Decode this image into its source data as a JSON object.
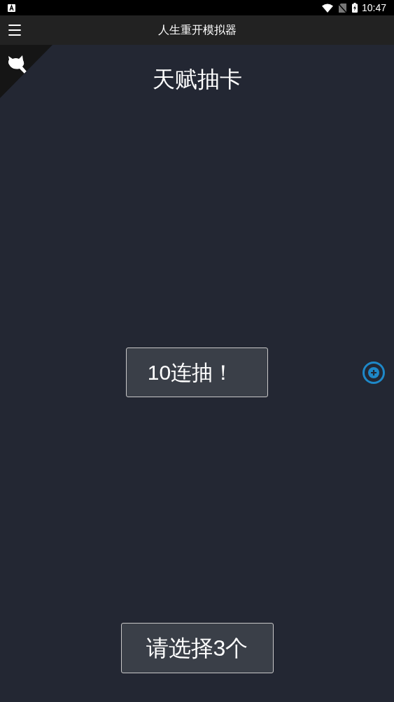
{
  "status_bar": {
    "time": "10:47"
  },
  "app_bar": {
    "title": "人生重开模拟器"
  },
  "page": {
    "title": "天赋抽卡"
  },
  "draw_button": {
    "label": "10连抽！"
  },
  "confirm_button": {
    "label": "请选择3个"
  }
}
